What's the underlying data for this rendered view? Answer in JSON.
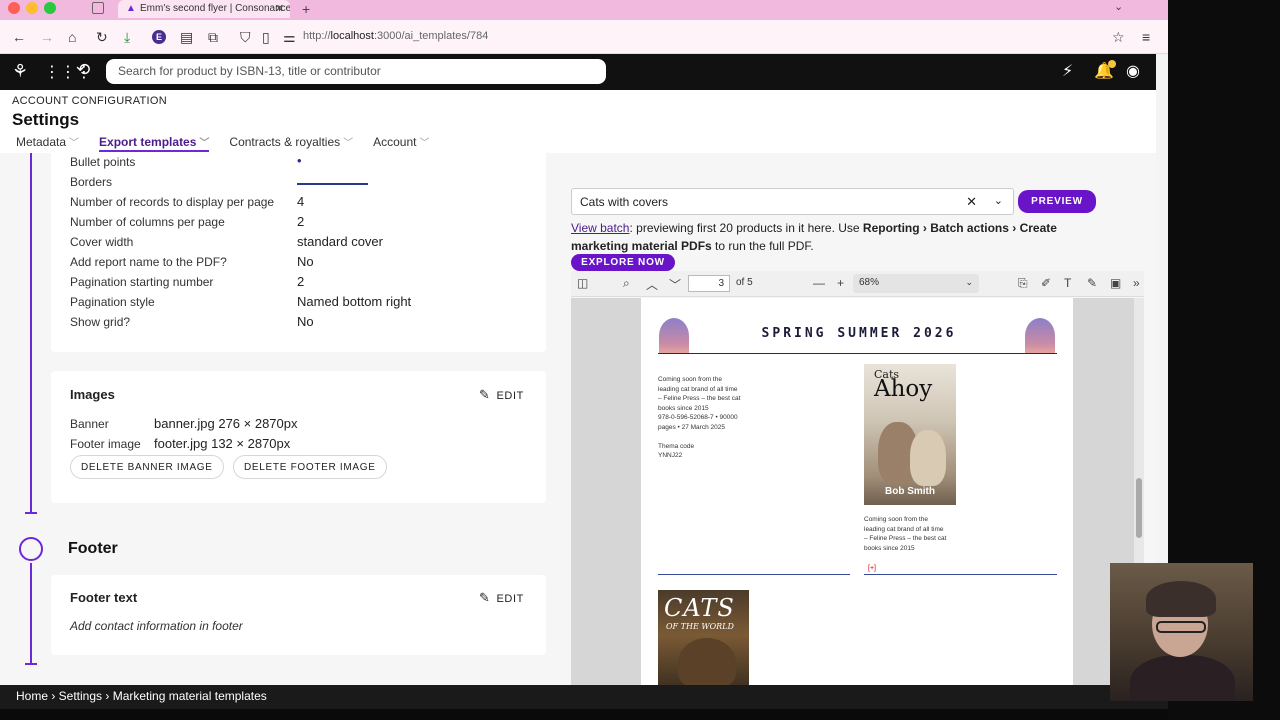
{
  "browser": {
    "tab_title": "Emm's second flyer | Consonance",
    "new_tab": "+",
    "url_prefix": "http://",
    "url_host": "localhost",
    "url_path": ":3000/ai_templates/784",
    "extension_letter": "E"
  },
  "app": {
    "search_placeholder": "Search for product by ISBN-13, title or contributor"
  },
  "settings": {
    "section_label": "ACCOUNT CONFIGURATION",
    "title": "Settings",
    "tabs": [
      "Metadata",
      "Export templates",
      "Contracts & royalties",
      "Account"
    ],
    "active_tab": "Export templates"
  },
  "template_settings": [
    {
      "label": "Bullet points",
      "value": "•"
    },
    {
      "label": "Borders",
      "value": ""
    },
    {
      "label": "Number of records to display per page",
      "value": "4"
    },
    {
      "label": "Number of columns per page",
      "value": "2"
    },
    {
      "label": "Cover width",
      "value": "standard cover"
    },
    {
      "label": "Add report name to the PDF?",
      "value": "No"
    },
    {
      "label": "Pagination starting number",
      "value": "2"
    },
    {
      "label": "Pagination style",
      "value": "Named bottom right"
    },
    {
      "label": "Show grid?",
      "value": "No"
    }
  ],
  "images_card": {
    "title": "Images",
    "edit_label": "EDIT",
    "banner_label": "Banner",
    "banner_value": "banner.jpg 276 × 2870px",
    "footer_label": "Footer image",
    "footer_value": "footer.jpg 132 × 2870px",
    "delete_banner": "DELETE BANNER IMAGE",
    "delete_footer": "DELETE FOOTER IMAGE"
  },
  "footer_section": {
    "heading": "Footer",
    "card_title": "Footer text",
    "edit_label": "EDIT",
    "placeholder": "Add contact information in footer"
  },
  "preview": {
    "batch_value": "Cats with covers",
    "preview_button": "PREVIEW",
    "info_link": "View batch",
    "info_text_1": ": previewing first 20 products in it here. Use ",
    "info_bold_1": "Reporting › Batch actions › Create marketing material PDFs",
    "info_text_2": " to run the full PDF.",
    "explore_button": "EXPLORE NOW",
    "page_number": "3",
    "page_of": "of 5",
    "zoom": "68%"
  },
  "pdf": {
    "title": "SPRING SUMMER 2026",
    "left_entry": [
      "Coming soon from the",
      "leading cat brand of all time",
      "– Feline Press – the best cat",
      "books since 2015",
      "978-0-596-52068-7 • 90000",
      "pages • 27 March 2025",
      "",
      "Thema code",
      "YNNJ22"
    ],
    "cover1_line1": "Cats",
    "cover1_line2": "Ahoy",
    "cover1_author": "Bob Smith",
    "right_entry": [
      "Coming soon from the",
      "leading cat brand of all time",
      "– Feline Press – the best cat",
      "books since 2015"
    ],
    "red_mark": "[+]",
    "cover2_line1": "CATS",
    "cover2_line2": "OF THE WORLD"
  },
  "breadcrumb": "Home › Settings › Marketing material templates",
  "colors": {
    "accent": "#6a14c9",
    "header_bg": "#111111",
    "tabstrip": "#f1b9de"
  }
}
